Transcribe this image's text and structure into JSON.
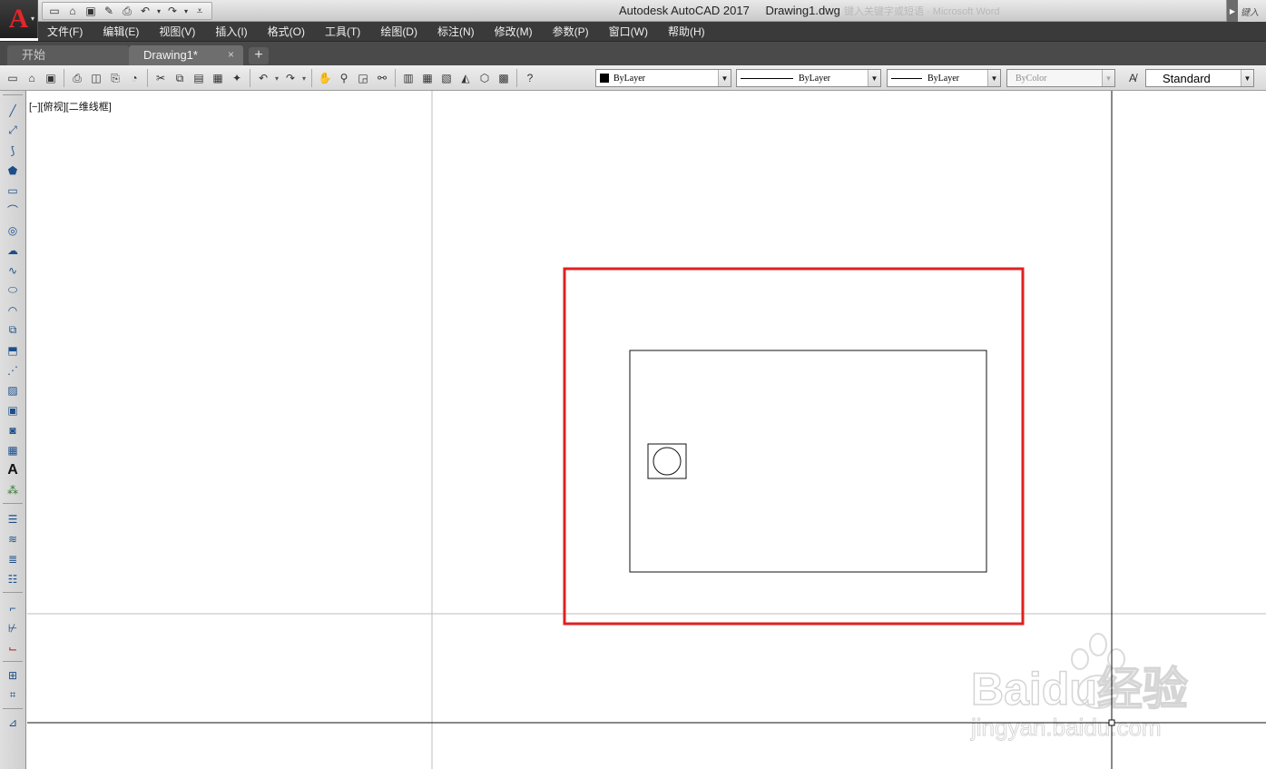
{
  "app": {
    "logo_letter": "A"
  },
  "window": {
    "title": "Autodesk AutoCAD 2017",
    "filename": "Drawing1.dwg",
    "ghost_text": "键入关键字或短语 · Microsoft Word",
    "search_stub": "键入"
  },
  "menu": [
    "文件(F)",
    "编辑(E)",
    "视图(V)",
    "插入(I)",
    "格式(O)",
    "工具(T)",
    "绘图(D)",
    "标注(N)",
    "修改(M)",
    "参数(P)",
    "窗口(W)",
    "帮助(H)"
  ],
  "tabs": [
    {
      "label": "开始",
      "active": false
    },
    {
      "label": "Drawing1*",
      "active": true
    }
  ],
  "tab_close": "×",
  "tab_add": "+",
  "properties": {
    "color": "ByLayer",
    "linetype": "ByLayer",
    "lineweight": "ByLayer",
    "plotstyle": "ByColor",
    "textstyle": "Standard"
  },
  "viewport": {
    "label": "[−][俯视][二维线框]"
  },
  "watermark": {
    "brand": "Baidu经验",
    "url": "jingyan.baidu.com"
  },
  "colors": {
    "highlight": "#e02020",
    "menubar": "#3a3a3a",
    "logo_red": "#e3262b"
  }
}
